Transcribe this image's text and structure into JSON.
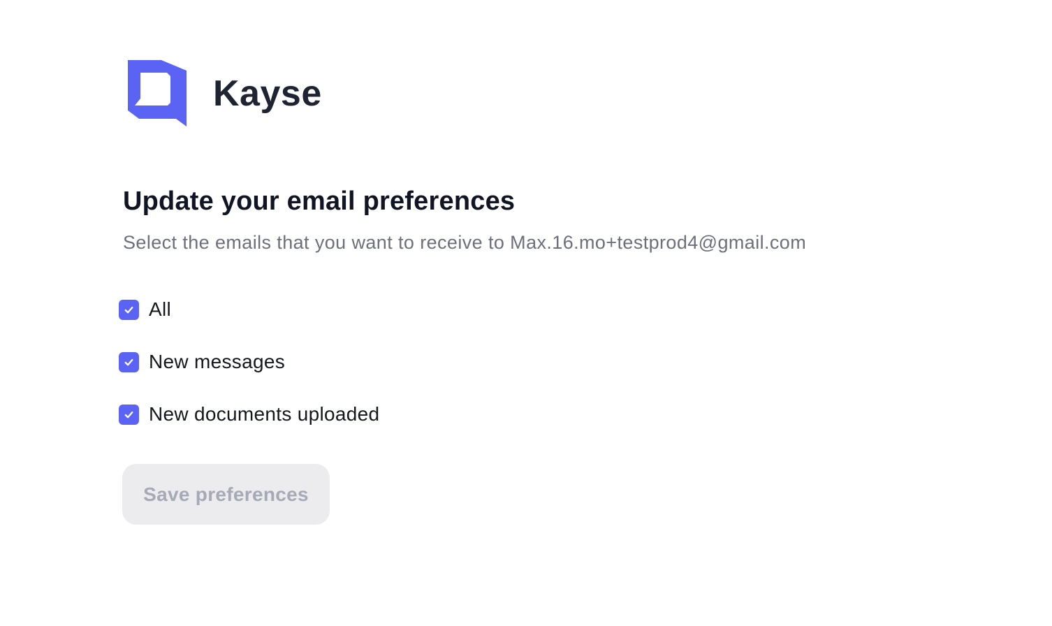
{
  "brand": {
    "name": "Kayse",
    "logo_icon": "kayse-logo-icon",
    "logo_color": "#5b63f5"
  },
  "heading": "Update your email preferences",
  "subtitle": "Select the emails that you want to receive to Max.16.mo+testprod4@gmail.com",
  "options": [
    {
      "label": "All",
      "checked": true
    },
    {
      "label": "New messages",
      "checked": true
    },
    {
      "label": "New documents uploaded",
      "checked": true
    }
  ],
  "save_button": {
    "label": "Save preferences",
    "state": "disabled"
  },
  "colors": {
    "accent": "#5b63f5",
    "heading": "#111422",
    "subtitle": "#6c6f7c",
    "button_disabled_bg": "#ececee",
    "button_disabled_text": "#a6aab6"
  }
}
